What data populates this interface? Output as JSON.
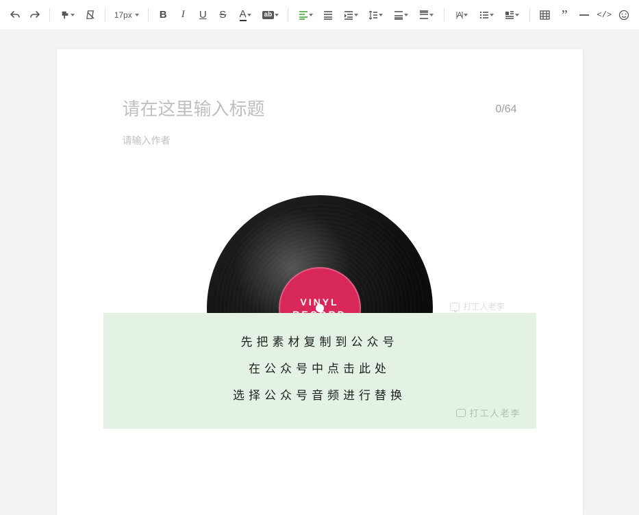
{
  "toolbar": {
    "font_size": "17px",
    "highlight_chip": "ab"
  },
  "editor": {
    "title_placeholder": "请在这里输入标题",
    "char_count": "0/64",
    "author_placeholder": "请输入作者"
  },
  "vinyl": {
    "label_line1": "VINYL",
    "label_line2": "RECORD"
  },
  "watermark": {
    "text": "打工人老李"
  },
  "instructions": {
    "line1": "先把素材复制到公众号",
    "line2": "在公众号中点击此处",
    "line3": "选择公众号音频进行替换",
    "watermark": "打工人老李"
  }
}
